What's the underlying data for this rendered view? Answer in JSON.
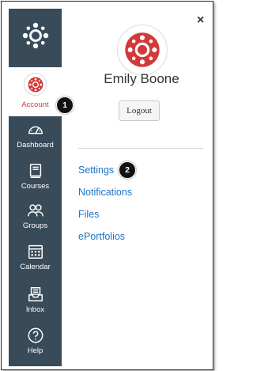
{
  "nav": {
    "logo": "canvas-logo-icon",
    "account_label": "Account",
    "items": [
      {
        "label": "Dashboard",
        "icon": "dashboard-icon"
      },
      {
        "label": "Courses",
        "icon": "courses-icon"
      },
      {
        "label": "Groups",
        "icon": "groups-icon"
      },
      {
        "label": "Calendar",
        "icon": "calendar-icon"
      },
      {
        "label": "Inbox",
        "icon": "inbox-icon"
      },
      {
        "label": "Help",
        "icon": "help-icon"
      }
    ],
    "background": "#394b58",
    "active_color": "#d23a3a"
  },
  "tray": {
    "close_symbol": "×",
    "user_name": "Emily Boone",
    "logout_label": "Logout",
    "links": [
      "Settings",
      "Notifications",
      "Files",
      "ePortfolios"
    ],
    "link_color": "#1d74c4"
  },
  "callouts": {
    "one": "1",
    "two": "2"
  }
}
